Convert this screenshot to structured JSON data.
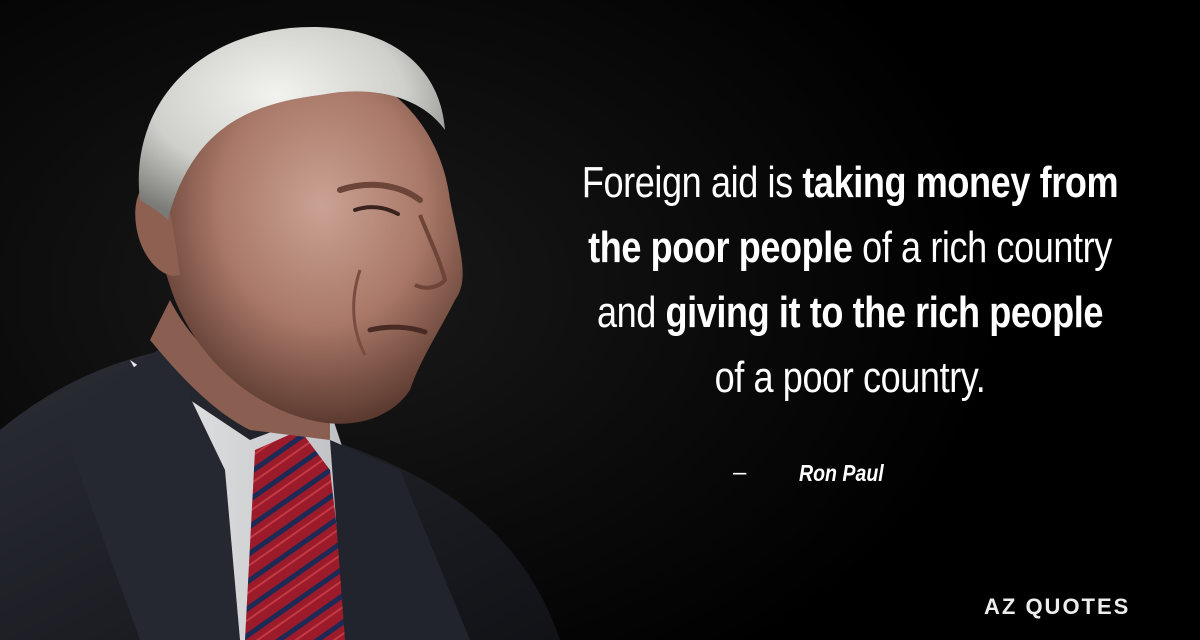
{
  "quote": {
    "lines": [
      [
        {
          "text": "Foreign aid is ",
          "style": "regular"
        },
        {
          "text": "taking money from",
          "style": "bold"
        }
      ],
      [
        {
          "text": "the poor people",
          "style": "bold"
        },
        {
          "text": " of a rich country",
          "style": "regular"
        }
      ],
      [
        {
          "text": "and ",
          "style": "regular"
        },
        {
          "text": "giving it to the rich people",
          "style": "bold"
        }
      ],
      [
        {
          "text": "of a poor country.",
          "style": "regular"
        }
      ]
    ]
  },
  "attribution": {
    "dash": "–",
    "author": "Ron Paul"
  },
  "watermark": {
    "text": "AZ QUOTES"
  },
  "colors": {
    "background": "#000000",
    "text": "#ffffff",
    "tie_red": "#9b1b2a",
    "suit": "#1d1f27"
  }
}
